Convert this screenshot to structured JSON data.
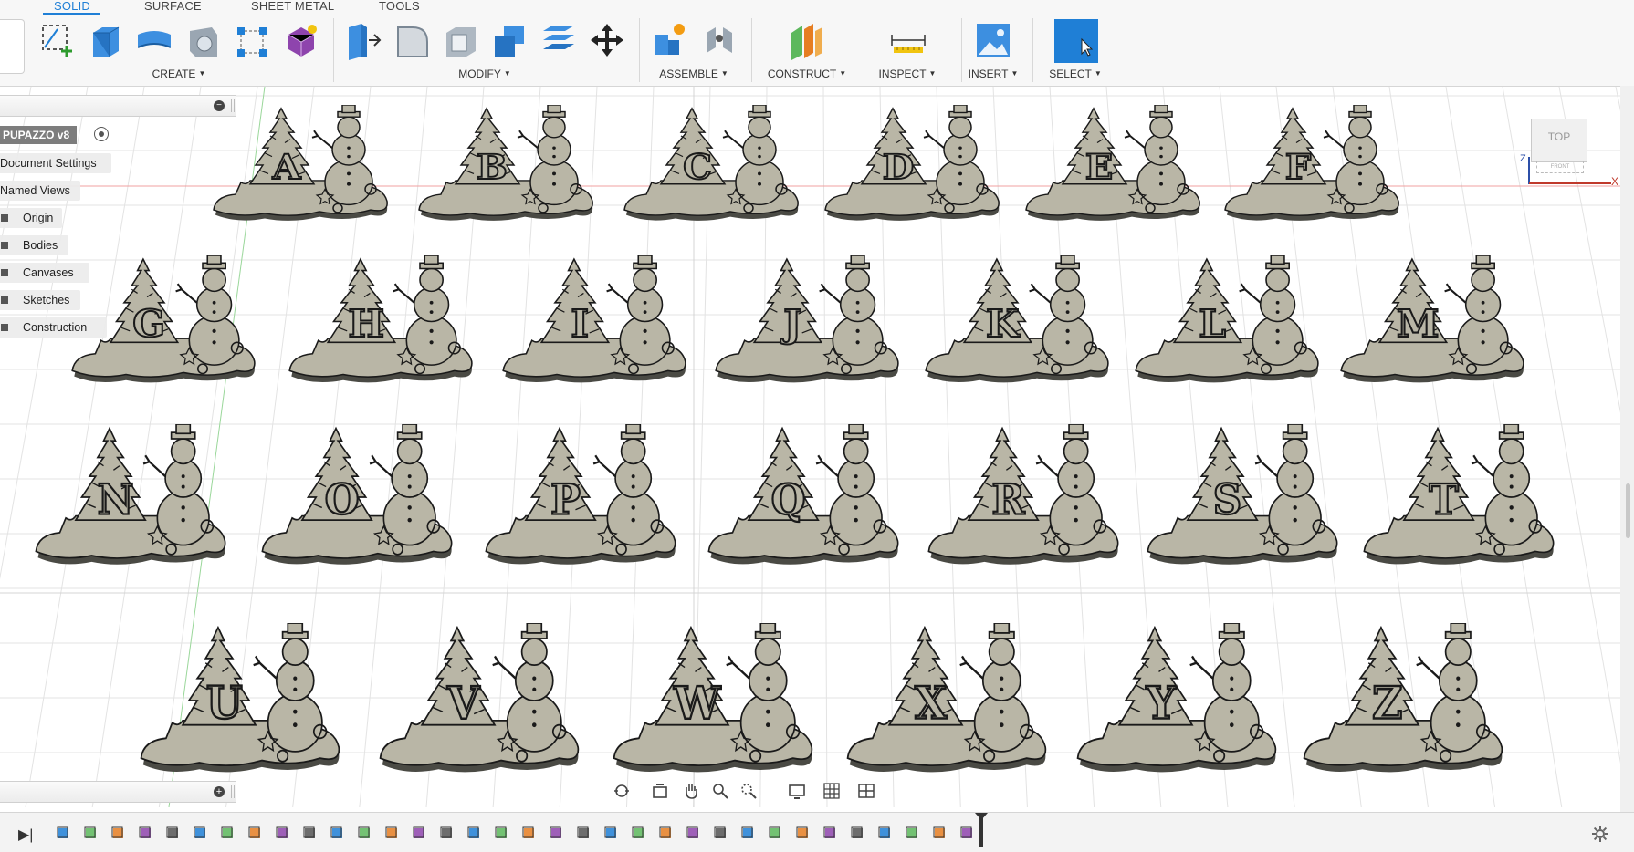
{
  "tabs": [
    {
      "label": "SOLID",
      "active": true
    },
    {
      "label": "SURFACE",
      "active": false
    },
    {
      "label": "SHEET METAL",
      "active": false
    },
    {
      "label": "TOOLS",
      "active": false
    }
  ],
  "toolbar_groups": [
    {
      "label": "CREATE",
      "icons": [
        "new-sketch-icon",
        "extrude-icon",
        "revolve-icon",
        "hole-icon",
        "pattern-icon",
        "form-icon"
      ]
    },
    {
      "label": "MODIFY",
      "icons": [
        "press-pull-icon",
        "fillet-icon",
        "shell-icon",
        "combine-icon",
        "offset-icon",
        "move-icon"
      ]
    },
    {
      "label": "ASSEMBLE",
      "icons": [
        "new-component-icon",
        "joint-icon"
      ]
    },
    {
      "label": "CONSTRUCT",
      "icons": [
        "offset-plane-icon"
      ]
    },
    {
      "label": "INSPECT",
      "icons": [
        "measure-icon"
      ]
    },
    {
      "label": "INSERT",
      "icons": [
        "insert-image-icon"
      ]
    },
    {
      "label": "SELECT",
      "icons": [
        "select-icon"
      ]
    }
  ],
  "browser": {
    "document": "PUPAZZO v8",
    "items": [
      {
        "label": "Document Settings",
        "has_box": false
      },
      {
        "label": "Named Views",
        "has_box": false
      },
      {
        "label": "Origin",
        "has_box": true
      },
      {
        "label": "Bodies",
        "has_box": true
      },
      {
        "label": "Canvases",
        "has_box": true
      },
      {
        "label": "Sketches",
        "has_box": true
      },
      {
        "label": "Construction",
        "has_box": true
      }
    ]
  },
  "viewcube": {
    "face": "TOP",
    "front": "FRONT",
    "axis_x": "X",
    "axis_z": "Z"
  },
  "ornament_letters": [
    "A",
    "B",
    "C",
    "D",
    "E",
    "F",
    "G",
    "H",
    "I",
    "J",
    "K",
    "L",
    "M",
    "N",
    "O",
    "P",
    "Q",
    "R",
    "S",
    "T",
    "U",
    "V",
    "W",
    "X",
    "Y",
    "Z"
  ],
  "nav_tools": [
    "orbit-icon",
    "look-at-icon",
    "pan-icon",
    "zoom-icon",
    "fit-icon",
    "display-settings-icon",
    "grid-icon",
    "viewports-icon"
  ],
  "timeline": {
    "features": 34
  },
  "colors": {
    "accent": "#1f7fd6",
    "body": "#b9b6a6",
    "outline": "#1a1a1a",
    "grid": "#e2e2e2"
  }
}
